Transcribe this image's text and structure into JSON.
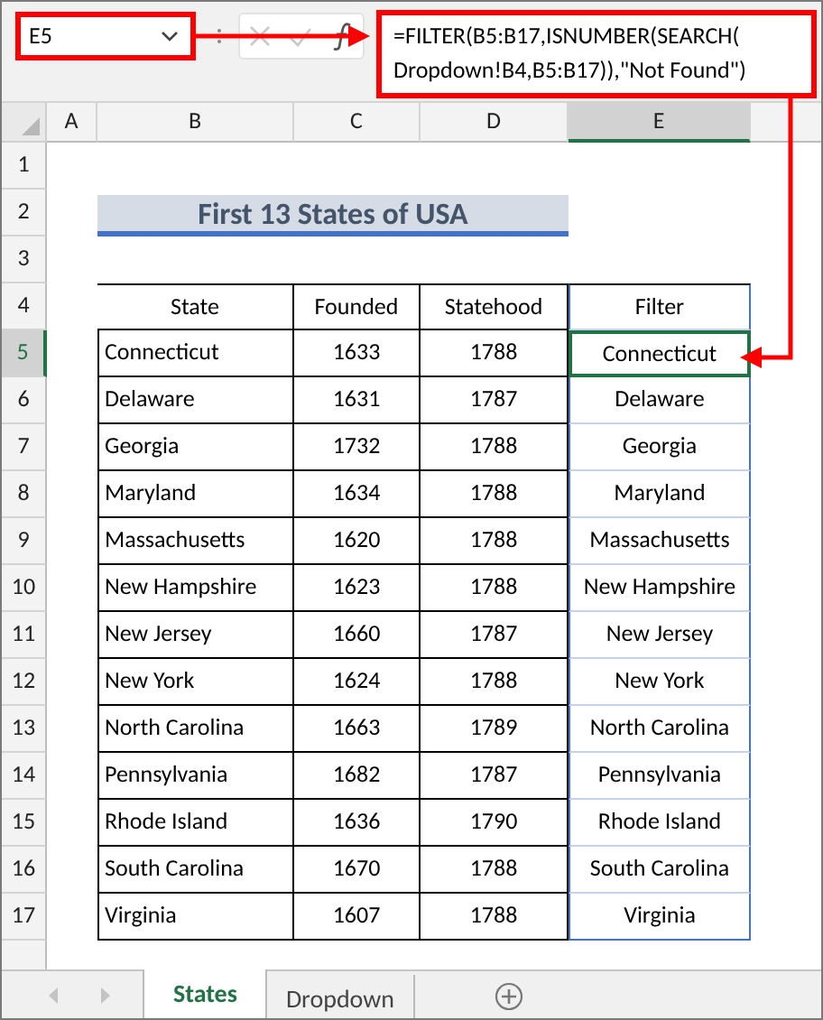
{
  "name_box": {
    "value": "E5"
  },
  "formula_bar": {
    "lines": [
      "=FILTER(B5:B17,ISNUMBER(SEARCH(",
      "Dropdown!B4,B5:B17)),\"Not Found\")"
    ]
  },
  "columns": [
    {
      "label": "A",
      "selected": false
    },
    {
      "label": "B",
      "selected": false
    },
    {
      "label": "C",
      "selected": false
    },
    {
      "label": "D",
      "selected": false
    },
    {
      "label": "E",
      "selected": true
    }
  ],
  "row_numbers": [
    {
      "label": "1",
      "selected": false
    },
    {
      "label": "2",
      "selected": false
    },
    {
      "label": "3",
      "selected": false
    },
    {
      "label": "4",
      "selected": false
    },
    {
      "label": "5",
      "selected": true
    },
    {
      "label": "6",
      "selected": false
    },
    {
      "label": "7",
      "selected": false
    },
    {
      "label": "8",
      "selected": false
    },
    {
      "label": "9",
      "selected": false
    },
    {
      "label": "10",
      "selected": false
    },
    {
      "label": "11",
      "selected": false
    },
    {
      "label": "12",
      "selected": false
    },
    {
      "label": "13",
      "selected": false
    },
    {
      "label": "14",
      "selected": false
    },
    {
      "label": "15",
      "selected": false
    },
    {
      "label": "16",
      "selected": false
    },
    {
      "label": "17",
      "selected": false
    }
  ],
  "title": "First 13 States of USA",
  "table": {
    "columns": [
      "State",
      "Founded",
      "Statehood",
      "Filter"
    ],
    "rows": [
      [
        "Connecticut",
        "1633",
        "1788",
        "Connecticut"
      ],
      [
        "Delaware",
        "1631",
        "1787",
        "Delaware"
      ],
      [
        "Georgia",
        "1732",
        "1788",
        "Georgia"
      ],
      [
        "Maryland",
        "1634",
        "1788",
        "Maryland"
      ],
      [
        "Massachusetts",
        "1620",
        "1788",
        "Massachusetts"
      ],
      [
        "New Hampshire",
        "1623",
        "1788",
        "New Hampshire"
      ],
      [
        "New Jersey",
        "1660",
        "1787",
        "New Jersey"
      ],
      [
        "New York",
        "1624",
        "1788",
        "New York"
      ],
      [
        "North Carolina",
        "1663",
        "1789",
        "North Carolina"
      ],
      [
        "Pennsylvania",
        "1682",
        "1787",
        "Pennsylvania"
      ],
      [
        "Rhode Island",
        "1636",
        "1790",
        "Rhode Island"
      ],
      [
        "South Carolina",
        "1670",
        "1788",
        "South Carolina"
      ],
      [
        "Virginia",
        "1607",
        "1788",
        "Virginia"
      ]
    ]
  },
  "sheet_tabs": [
    {
      "label": "States",
      "selected": true
    },
    {
      "label": "Dropdown",
      "selected": false
    }
  ]
}
